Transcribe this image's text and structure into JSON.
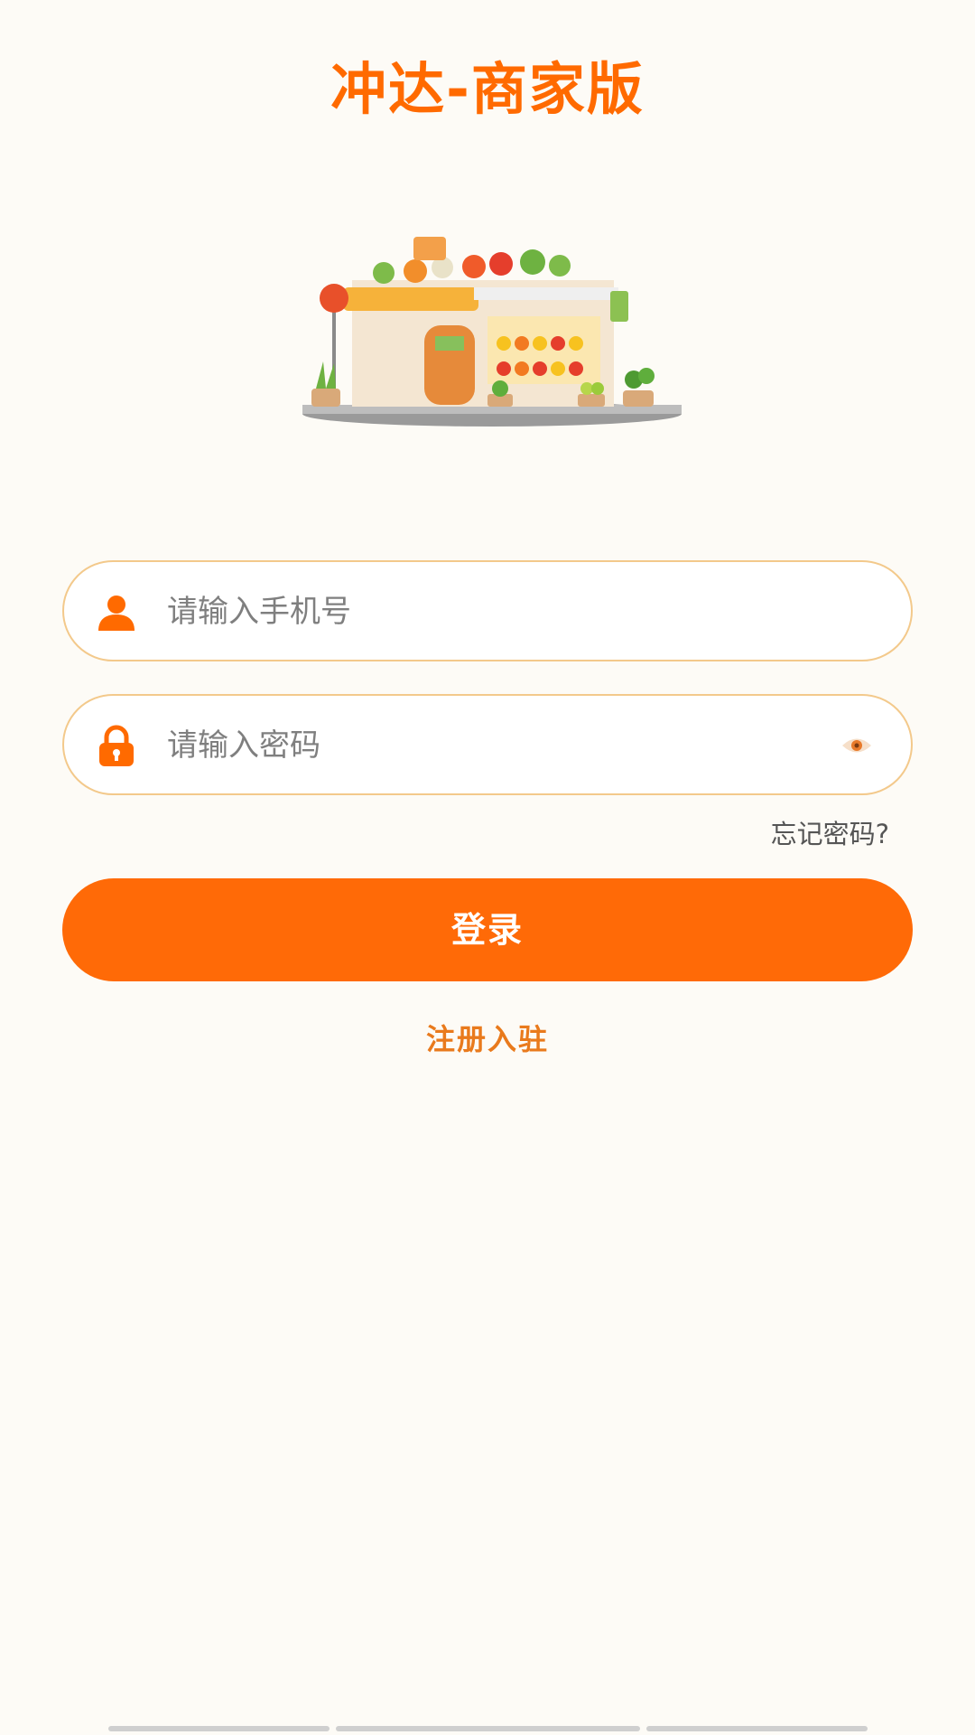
{
  "header": {
    "title": "冲达-商家版"
  },
  "form": {
    "phone": {
      "placeholder": "请输入手机号",
      "icon": "user-icon"
    },
    "password": {
      "placeholder": "请输入密码",
      "icon": "lock-icon",
      "toggle_icon": "eye-icon"
    },
    "forgot_label": "忘记密码?",
    "login_label": "登录",
    "register_label": "注册入驻"
  },
  "colors": {
    "accent": "#FF6A00",
    "background": "#FDFBF6",
    "field_border": "#F3C98B",
    "register_text": "#E97A1C"
  }
}
